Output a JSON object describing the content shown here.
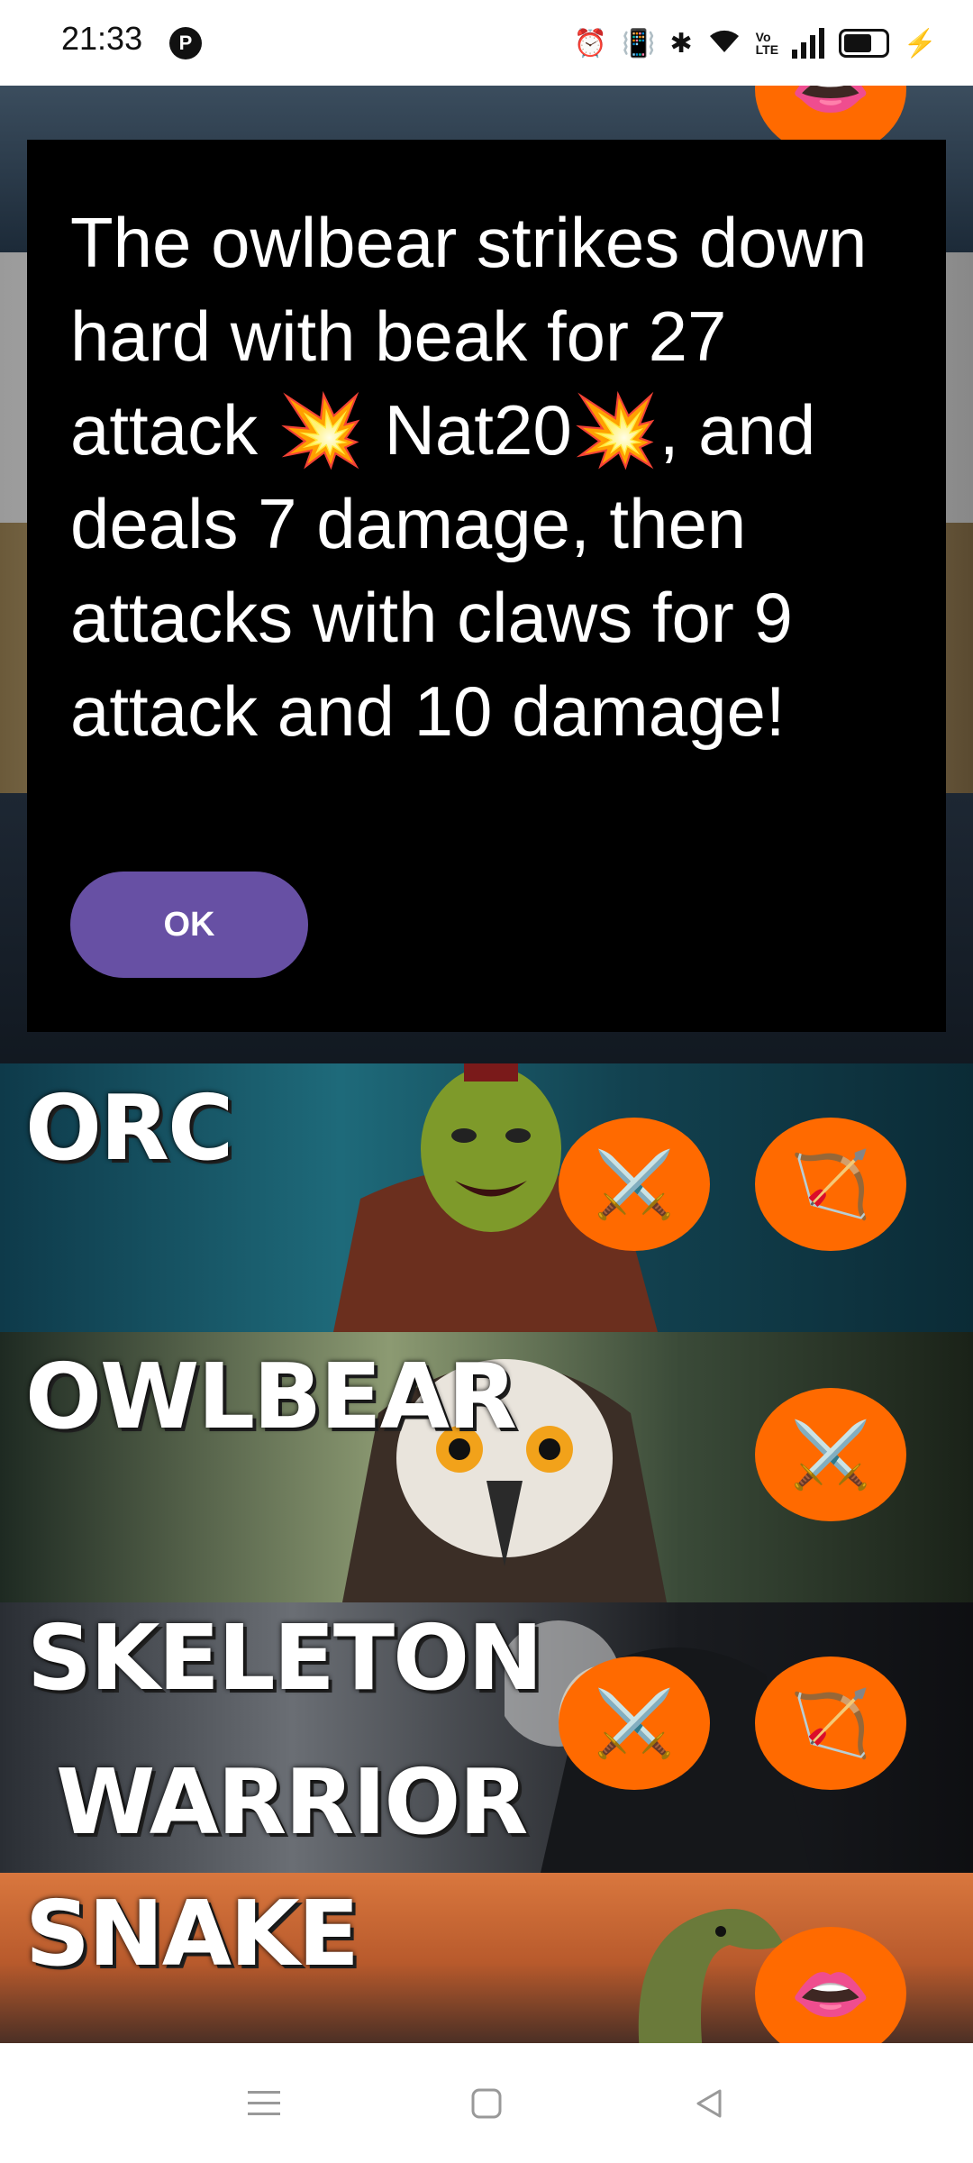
{
  "status_bar": {
    "time": "21:33",
    "app_icon_letter": "P",
    "icons": [
      "alarm-icon",
      "vibrate-icon",
      "bluetooth-icon",
      "wifi-icon",
      "volte-icon",
      "signal-icon",
      "battery-icon",
      "charging-icon"
    ],
    "volte_label": "Vo LTE"
  },
  "dialog": {
    "message": "The owlbear strikes down hard with beak for 27 attack 💥 Nat20💥, and deals 7 damage, then attacks with claws for 9 attack and 10 damage!",
    "ok_label": "OK"
  },
  "creatures": [
    {
      "name": "ORC",
      "actions": [
        "melee",
        "ranged"
      ]
    },
    {
      "name": "OWLBEAR",
      "actions": [
        "melee"
      ]
    },
    {
      "name": "SKELETON WARRIOR",
      "line1": "SKELETON",
      "line2": "WARRIOR",
      "actions": [
        "melee",
        "ranged"
      ]
    },
    {
      "name": "SNAKE",
      "actions": [
        "bite"
      ]
    }
  ],
  "action_icons": {
    "melee": "⚔️",
    "ranged": "🏹",
    "bite": "👄"
  },
  "colors": {
    "action_button": "#ff6a00",
    "ok_button": "#6750a4",
    "dialog_bg": "#000000"
  }
}
